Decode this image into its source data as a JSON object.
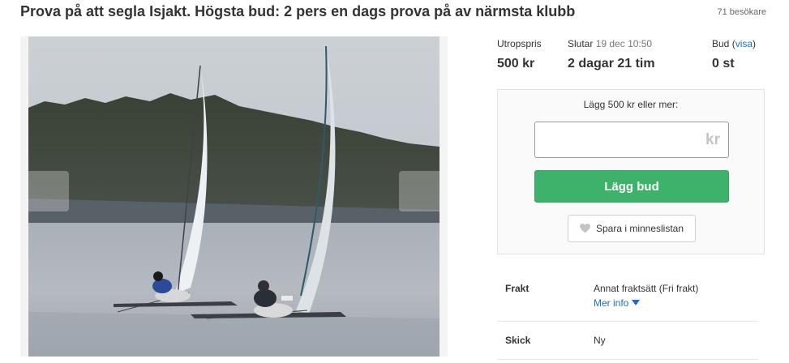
{
  "listing": {
    "title": "Prova på att segla Isjakt. Högsta bud: 2 pers en dags prova på av närmsta klubb",
    "visitors": "71 besökare"
  },
  "stats": {
    "start_price_label": "Utropspris",
    "start_price_value": "500 kr",
    "ends_label": "Slutar",
    "ends_date": "19 dec 10:50",
    "ends_value": "2 dagar 21 tim",
    "bids_label": "Bud",
    "bids_link_open": "(",
    "bids_link": "visa",
    "bids_link_close": ")",
    "bids_value": "0 st"
  },
  "bid": {
    "hint": "Lägg 500 kr eller mer:",
    "input_value": "",
    "currency": "kr",
    "button_label": "Lägg bud",
    "save_label": "Spara i minneslistan"
  },
  "details": {
    "shipping_label": "Frakt",
    "shipping_value": "Annat fraktsätt (Fri frakt)",
    "more_info": "Mer info",
    "condition_label": "Skick",
    "condition_value": "Ny"
  },
  "icons": {
    "heart": "heart-icon",
    "caret": "caret-down-icon",
    "prev": "chevron-left-icon",
    "next": "chevron-right-icon"
  },
  "colors": {
    "accent_green": "#3cb26a",
    "link_blue": "#1a6cc8"
  }
}
